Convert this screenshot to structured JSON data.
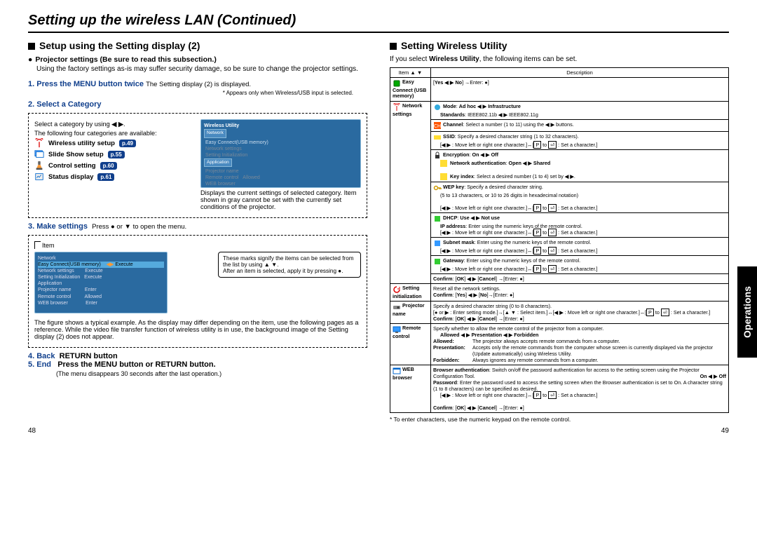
{
  "header": {
    "title": "Setting up the wireless LAN (Continued)"
  },
  "sidetab": "Operations",
  "footer": {
    "left": "48",
    "right": "49"
  },
  "left": {
    "section_title": "Setup using the Setting display (2)",
    "subsection": "Projector settings (Be sure to read this subsection.)",
    "sub_note": "Using the factory settings as-is may suffer security damage, so be sure to change the projector settings.",
    "step1": {
      "label": "1. Press the MENU button twice",
      "desc": "The Setting display (2) is displayed.",
      "footnote": "* Appears only when Wireless/USB input is selected."
    },
    "step2": {
      "label": "2. Select a Category",
      "intro1": "Select a category by using",
      "intro2": "The following four categories are available:",
      "cats": [
        {
          "label": "Wireless utility setup",
          "page": "p.49"
        },
        {
          "label": "Slide Show setup",
          "page": "p.55"
        },
        {
          "label": "Control setting",
          "page": "p.60"
        },
        {
          "label": "Status display",
          "page": "p.61"
        }
      ],
      "osd_desc": "Displays the current settings of selected category. Item shown in gray cannot be set with the currently set conditions of the projector."
    },
    "step3": {
      "label": "3. Make settings",
      "desc_pre": "Press",
      "desc_post": "to open the menu.",
      "item_label": "Item",
      "callout1": "These marks signify the items can be selected from the list by using",
      "callout2": "After an item is selected, apply it by pressing",
      "note": "The figure shows a typical example. As the display may differ depending on the item, use the following pages as a reference.\nWhile the video file transfer function of wireless utility is in use, the background image of the Setting display (2) does not appear."
    },
    "step4": {
      "num": "4. Back",
      "text": "RETURN button"
    },
    "step5": {
      "num": "5. End",
      "text": "Press the MENU button or RETURN button.",
      "note": "(The menu disappears 30 seconds after the last operation.)"
    }
  },
  "right": {
    "section_title": "Setting Wireless Utility",
    "intro_pre": "If you select ",
    "intro_bold": "Wireless Utility",
    "intro_post": ", the following items can be set.",
    "movechar": "Move left or right one character.",
    "setchar": "Set a character.",
    "table": {
      "headers": [
        "Item  ▲ ▼",
        "Description"
      ],
      "rows": [
        {
          "item": "Easy Connect (USB memory)",
          "d": {
            "yes": "Yes",
            "no": "No"
          }
        },
        {
          "item": "Network settings",
          "d": [
            {
              "k": "Mode",
              "sub": "Standards"
            },
            {
              "t": "Select a number (1 to 11) using the"
            },
            {
              "t": "Specify a desired character string (1 to 32 characters)."
            },
            {
              "ki": "Select a desired number (1 to 4) set by"
            },
            {
              "t1": "Specify a desired character string.",
              "t2": "(5 to 13 characters, or 10 to 26 digits in hexadecimal notation)"
            },
            {
              "t": "Enter using the numeric keys of the remote control."
            },
            {
              "t": "Enter using the numeric keys of the remote control."
            },
            {
              "t": "Enter using the numeric keys of the remote control."
            }
          ]
        },
        {
          "item": "Setting initialization",
          "d": {
            "t": "Reset all the network settings."
          }
        },
        {
          "item": "Projector name",
          "d": {
            "t1": "Specify a desired character string (0 to 8 characters)."
          }
        },
        {
          "item": "Remote control",
          "d": {
            "t1": "Specify whether to allow the remote control of the projector from a computer.",
            "allowed": "The projector always accepts remote commands from a computer.",
            "presentation": "Accepts only the remote commands from the computer whose screen is currently displayed via the projector (Update automatically) using Wireless Utility.",
            "forbidden": "Always ignores any remote commands from a computer."
          }
        },
        {
          "item": "WEB browser",
          "d": {
            "ba": "Switch on/off the password authentication for access to the setting screen using the Projector Configuration Tool.",
            "pw": "Enter the password used to access the setting screen when the Browser authentication is set to On. A character string (1 to 8 characters) can be specified as desired."
          }
        }
      ]
    },
    "footnote": "*  To enter characters, use the numeric keypad on the remote control."
  }
}
